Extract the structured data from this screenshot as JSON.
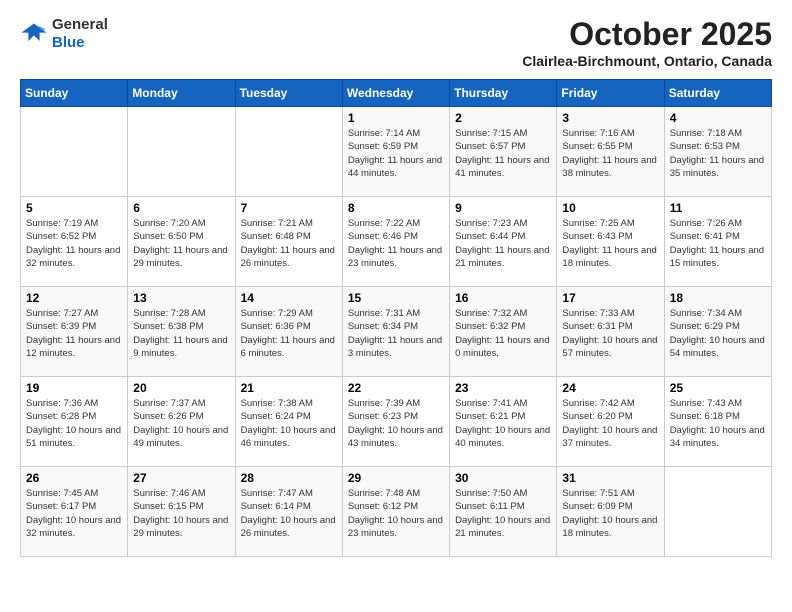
{
  "logo": {
    "general": "General",
    "blue": "Blue"
  },
  "title": {
    "month_year": "October 2025",
    "location": "Clairlea-Birchmount, Ontario, Canada"
  },
  "days_of_week": [
    "Sunday",
    "Monday",
    "Tuesday",
    "Wednesday",
    "Thursday",
    "Friday",
    "Saturday"
  ],
  "weeks": [
    [
      {
        "day": "",
        "info": ""
      },
      {
        "day": "",
        "info": ""
      },
      {
        "day": "",
        "info": ""
      },
      {
        "day": "1",
        "info": "Sunrise: 7:14 AM\nSunset: 6:59 PM\nDaylight: 11 hours and 44 minutes."
      },
      {
        "day": "2",
        "info": "Sunrise: 7:15 AM\nSunset: 6:57 PM\nDaylight: 11 hours and 41 minutes."
      },
      {
        "day": "3",
        "info": "Sunrise: 7:16 AM\nSunset: 6:55 PM\nDaylight: 11 hours and 38 minutes."
      },
      {
        "day": "4",
        "info": "Sunrise: 7:18 AM\nSunset: 6:53 PM\nDaylight: 11 hours and 35 minutes."
      }
    ],
    [
      {
        "day": "5",
        "info": "Sunrise: 7:19 AM\nSunset: 6:52 PM\nDaylight: 11 hours and 32 minutes."
      },
      {
        "day": "6",
        "info": "Sunrise: 7:20 AM\nSunset: 6:50 PM\nDaylight: 11 hours and 29 minutes."
      },
      {
        "day": "7",
        "info": "Sunrise: 7:21 AM\nSunset: 6:48 PM\nDaylight: 11 hours and 26 minutes."
      },
      {
        "day": "8",
        "info": "Sunrise: 7:22 AM\nSunset: 6:46 PM\nDaylight: 11 hours and 23 minutes."
      },
      {
        "day": "9",
        "info": "Sunrise: 7:23 AM\nSunset: 6:44 PM\nDaylight: 11 hours and 21 minutes."
      },
      {
        "day": "10",
        "info": "Sunrise: 7:25 AM\nSunset: 6:43 PM\nDaylight: 11 hours and 18 minutes."
      },
      {
        "day": "11",
        "info": "Sunrise: 7:26 AM\nSunset: 6:41 PM\nDaylight: 11 hours and 15 minutes."
      }
    ],
    [
      {
        "day": "12",
        "info": "Sunrise: 7:27 AM\nSunset: 6:39 PM\nDaylight: 11 hours and 12 minutes."
      },
      {
        "day": "13",
        "info": "Sunrise: 7:28 AM\nSunset: 6:38 PM\nDaylight: 11 hours and 9 minutes."
      },
      {
        "day": "14",
        "info": "Sunrise: 7:29 AM\nSunset: 6:36 PM\nDaylight: 11 hours and 6 minutes."
      },
      {
        "day": "15",
        "info": "Sunrise: 7:31 AM\nSunset: 6:34 PM\nDaylight: 11 hours and 3 minutes."
      },
      {
        "day": "16",
        "info": "Sunrise: 7:32 AM\nSunset: 6:32 PM\nDaylight: 11 hours and 0 minutes."
      },
      {
        "day": "17",
        "info": "Sunrise: 7:33 AM\nSunset: 6:31 PM\nDaylight: 10 hours and 57 minutes."
      },
      {
        "day": "18",
        "info": "Sunrise: 7:34 AM\nSunset: 6:29 PM\nDaylight: 10 hours and 54 minutes."
      }
    ],
    [
      {
        "day": "19",
        "info": "Sunrise: 7:36 AM\nSunset: 6:28 PM\nDaylight: 10 hours and 51 minutes."
      },
      {
        "day": "20",
        "info": "Sunrise: 7:37 AM\nSunset: 6:26 PM\nDaylight: 10 hours and 49 minutes."
      },
      {
        "day": "21",
        "info": "Sunrise: 7:38 AM\nSunset: 6:24 PM\nDaylight: 10 hours and 46 minutes."
      },
      {
        "day": "22",
        "info": "Sunrise: 7:39 AM\nSunset: 6:23 PM\nDaylight: 10 hours and 43 minutes."
      },
      {
        "day": "23",
        "info": "Sunrise: 7:41 AM\nSunset: 6:21 PM\nDaylight: 10 hours and 40 minutes."
      },
      {
        "day": "24",
        "info": "Sunrise: 7:42 AM\nSunset: 6:20 PM\nDaylight: 10 hours and 37 minutes."
      },
      {
        "day": "25",
        "info": "Sunrise: 7:43 AM\nSunset: 6:18 PM\nDaylight: 10 hours and 34 minutes."
      }
    ],
    [
      {
        "day": "26",
        "info": "Sunrise: 7:45 AM\nSunset: 6:17 PM\nDaylight: 10 hours and 32 minutes."
      },
      {
        "day": "27",
        "info": "Sunrise: 7:46 AM\nSunset: 6:15 PM\nDaylight: 10 hours and 29 minutes."
      },
      {
        "day": "28",
        "info": "Sunrise: 7:47 AM\nSunset: 6:14 PM\nDaylight: 10 hours and 26 minutes."
      },
      {
        "day": "29",
        "info": "Sunrise: 7:48 AM\nSunset: 6:12 PM\nDaylight: 10 hours and 23 minutes."
      },
      {
        "day": "30",
        "info": "Sunrise: 7:50 AM\nSunset: 6:11 PM\nDaylight: 10 hours and 21 minutes."
      },
      {
        "day": "31",
        "info": "Sunrise: 7:51 AM\nSunset: 6:09 PM\nDaylight: 10 hours and 18 minutes."
      },
      {
        "day": "",
        "info": ""
      }
    ]
  ]
}
